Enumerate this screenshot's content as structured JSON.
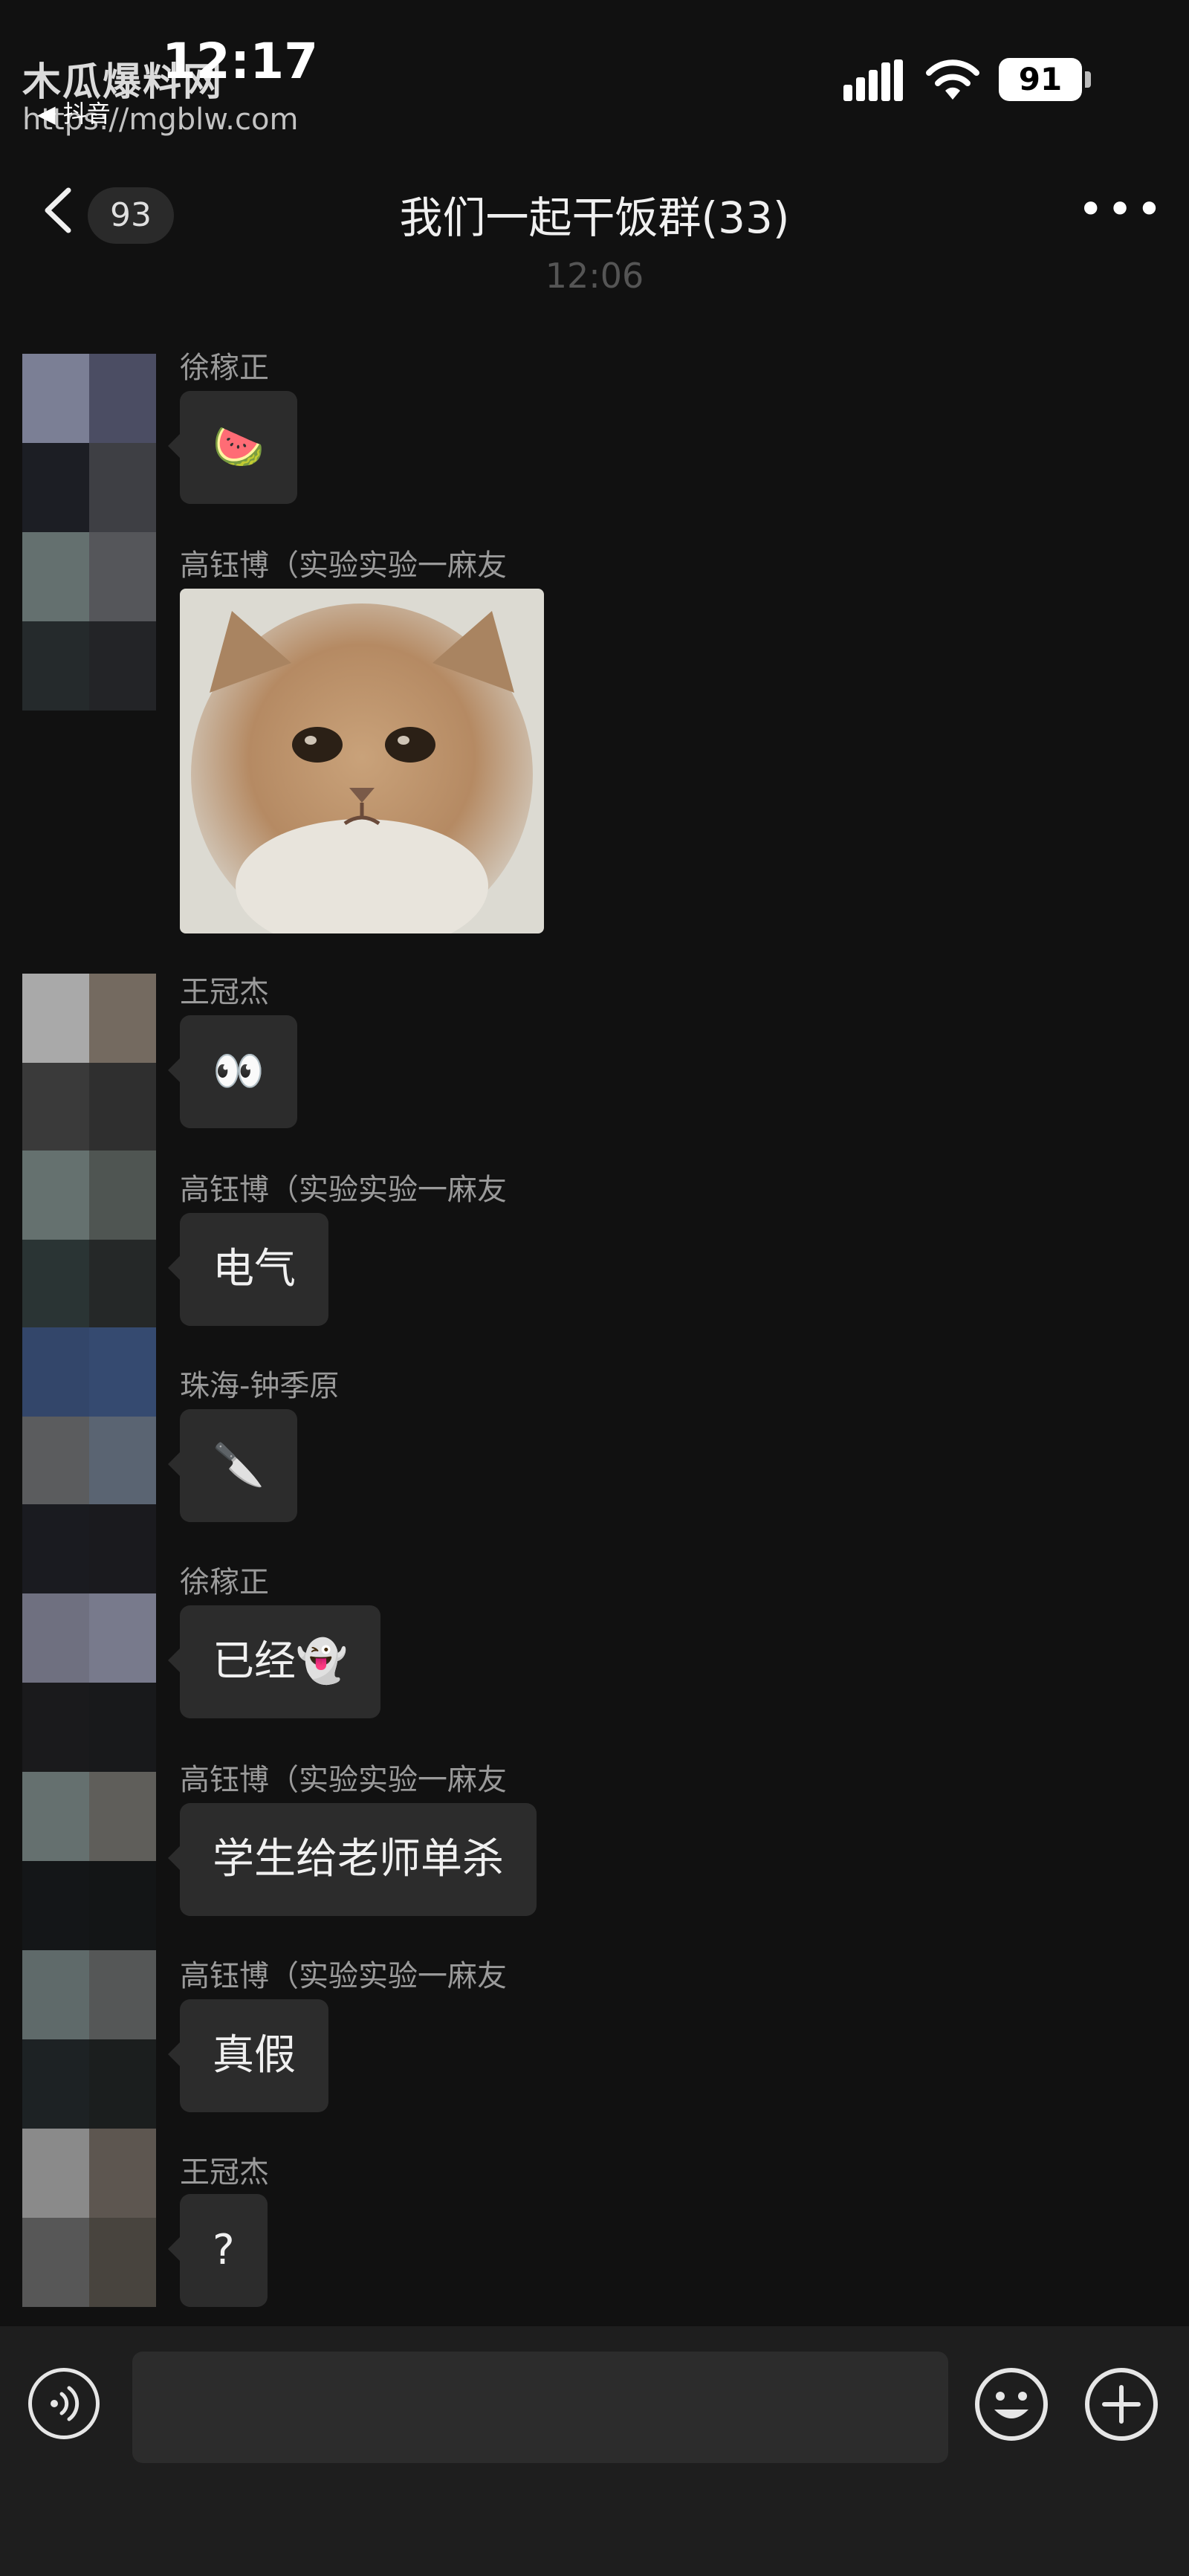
{
  "status_bar": {
    "time": "12:17",
    "back_app": "◀ 抖音",
    "battery": "91",
    "watermark": "木瓜爆料网",
    "watermark_url": "https://mgblw.com"
  },
  "header": {
    "unread_count": "93",
    "title": "我们一起干饭群(33)",
    "more_label": "•••"
  },
  "timestamp": "12:06",
  "messages": [
    {
      "sender": "徐稼正",
      "text": "🍉"
    },
    {
      "sender": "高钰博（实验实验一麻友",
      "image": "crying-kitten-sticker"
    },
    {
      "sender": "王冠杰",
      "text": "👀"
    },
    {
      "sender": "高钰博（实验实验一麻友",
      "text": "电气"
    },
    {
      "sender": "珠海-钟季原",
      "text": "🔪"
    },
    {
      "sender": "徐稼正",
      "text": "已经👻"
    },
    {
      "sender": "高钰博（实验实验一麻友",
      "text": "学生给老师单杀"
    },
    {
      "sender": "高钰博（实验实验一麻友",
      "text": "真假"
    },
    {
      "sender": "王冠杰",
      "text": "?"
    }
  ],
  "input_bar": {
    "placeholder": "",
    "voice_icon": "voice-icon",
    "emoji_icon": "emoji-icon",
    "plus_icon": "plus-icon"
  },
  "colors": {
    "background": "#111111",
    "bubble": "#2c2c2c",
    "sender_text": "#9a9a9a",
    "timestamp": "#555555"
  }
}
